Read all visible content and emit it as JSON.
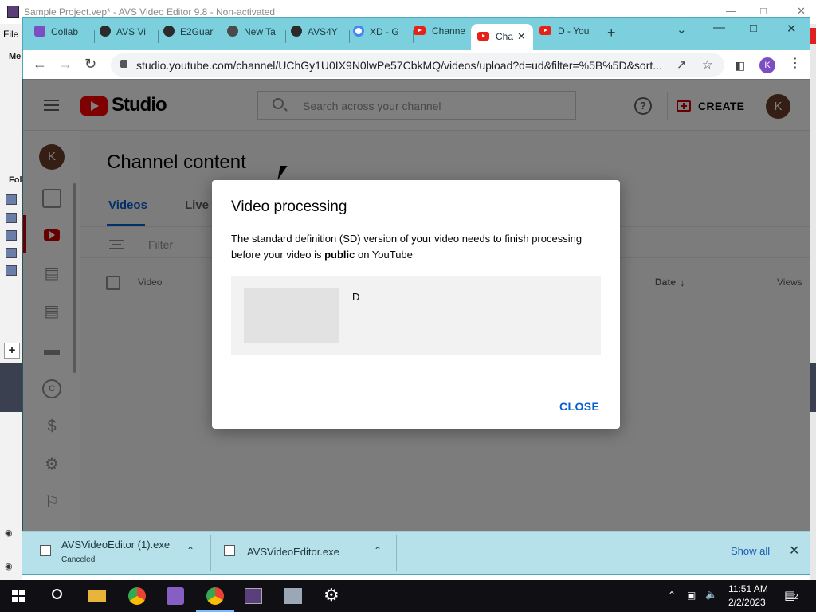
{
  "avs_window": {
    "title": "Sample Project.vep* - AVS Video Editor 9.8 - Non-activated",
    "menu_file": "File",
    "menu_partial": "Me",
    "folder_partial": "Fol"
  },
  "browser": {
    "tabs": [
      {
        "label": "Collab",
        "icon": "tab-favicon-icon",
        "color": "#7d4dc2"
      },
      {
        "label": "AVS Vi",
        "icon": "globe-icon",
        "color": "#2b2b2b"
      },
      {
        "label": "E2Guar",
        "icon": "globe-icon",
        "color": "#2b2b2b"
      },
      {
        "label": "New Ta",
        "icon": "chrome-icon",
        "color": "#4a4a4a"
      },
      {
        "label": "AVS4Y",
        "icon": "avs4you-icon",
        "color": "#2b2b2b"
      },
      {
        "label": "XD - G",
        "icon": "google-icon",
        "color": "#4285f4"
      },
      {
        "label": "Channe",
        "icon": "youtube-icon",
        "color": "#e62117"
      },
      {
        "label": "Cha",
        "icon": "youtube-icon",
        "color": "#e62117",
        "active": true
      },
      {
        "label": "D - You",
        "icon": "youtube-icon",
        "color": "#e62117"
      }
    ],
    "url": "studio.youtube.com/channel/UChGy1U0IX9N0lwPe57CbkMQ/videos/upload?d=ud&filter=%5B%5D&sort...",
    "profile_initial": "K"
  },
  "studio": {
    "logo_text": "Studio",
    "search_placeholder": "Search across your channel",
    "help_glyph": "?",
    "create_label": "CREATE",
    "account_initial": "K",
    "sidebar_initial": "K",
    "page_title": "Channel content",
    "tabs": [
      "Videos",
      "Live"
    ],
    "filter_label": "Filter",
    "columns": {
      "video": "Video",
      "date": "Date",
      "views": "Views"
    },
    "date_sort_icon": "arrow-down-icon"
  },
  "dialog": {
    "title": "Video processing",
    "message_before": "The standard definition (SD) version of your video needs to finish processing before your video is ",
    "message_bold": "public",
    "message_after": " on YouTube",
    "video_title": "D",
    "close_label": "CLOSE"
  },
  "downloads": [
    {
      "name": "AVSVideoEditor (1).exe",
      "status": "Canceled"
    },
    {
      "name": "AVSVideoEditor.exe",
      "status": ""
    }
  ],
  "download_bar": {
    "show_all": "Show all"
  },
  "taskbar": {
    "time": "11:51 AM",
    "date": "2/2/2023",
    "notifications": "2"
  },
  "colors": {
    "accent_blue": "#065fd4",
    "youtube_red": "#ff0000",
    "tabstrip": "#7ccfdc",
    "download_bar": "#b6e1ea"
  }
}
